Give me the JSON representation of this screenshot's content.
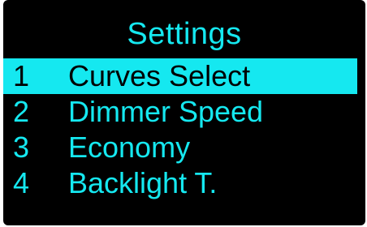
{
  "header": {
    "title": "Settings"
  },
  "menu": {
    "items": [
      {
        "number": "1",
        "label": "Curves Select",
        "selected": true
      },
      {
        "number": "2",
        "label": "Dimmer Speed",
        "selected": false
      },
      {
        "number": "3",
        "label": "Economy",
        "selected": false
      },
      {
        "number": "4",
        "label": "Backlight T.",
        "selected": false
      }
    ]
  },
  "colors": {
    "background": "#000000",
    "accent": "#15e8f0",
    "selected_text": "#000000"
  }
}
